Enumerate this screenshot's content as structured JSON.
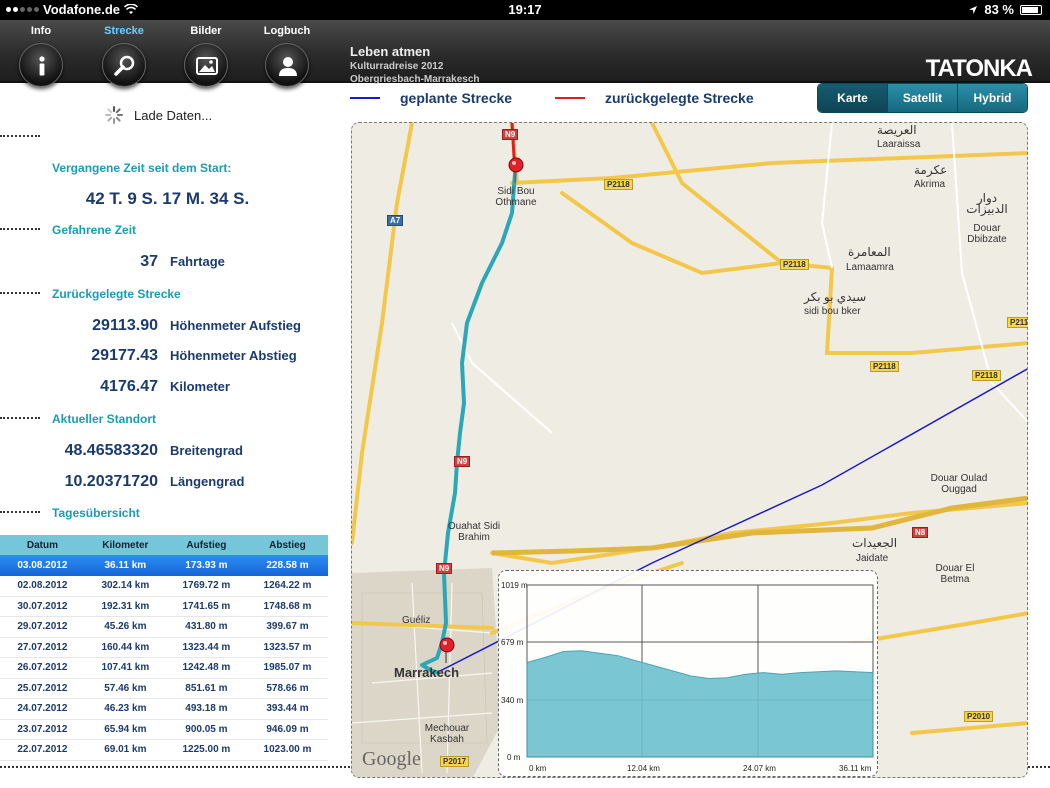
{
  "status": {
    "carrier": "Vodafone.de",
    "time": "19:17",
    "battery": "83 %"
  },
  "nav": [
    {
      "label": "Info",
      "icon": "info-icon"
    },
    {
      "label": "Strecke",
      "icon": "search-icon"
    },
    {
      "label": "Bilder",
      "icon": "image-icon"
    },
    {
      "label": "Logbuch",
      "icon": "user-icon"
    }
  ],
  "trip": {
    "title": "Leben atmen",
    "subtitle": "Kulturradreise 2012",
    "route": "Obergriesbach-Marrakesch"
  },
  "logo": "TATONKA",
  "loading": "Lade Daten...",
  "stats": {
    "elapsed_head": "Vergangene Zeit seit dem Start:",
    "elapsed": "42 T. 9 S. 17 M. 34 S.",
    "driven_head": "Gefahrene Zeit",
    "days_val": "37",
    "days_unit": "Fahrtage",
    "distance_head": "Zurückgelegte Strecke",
    "up_val": "29113.90",
    "up_unit": "Höhenmeter Aufstieg",
    "down_val": "29177.43",
    "down_unit": "Höhenmeter Abstieg",
    "km_val": "4176.47",
    "km_unit": "Kilometer",
    "pos_head": "Aktueller Standort",
    "lat_val": "48.46583320",
    "lat_unit": "Breitengrad",
    "lon_val": "10.20371720",
    "lon_unit": "Längengrad",
    "daily_head": "Tagesübersicht"
  },
  "table": {
    "headers": [
      "Datum",
      "Kilometer",
      "Aufstieg",
      "Abstieg"
    ],
    "rows": [
      [
        "03.08.2012",
        "36.11 km",
        "173.93 m",
        "228.58 m"
      ],
      [
        "02.08.2012",
        "302.14 km",
        "1769.72 m",
        "1264.22 m"
      ],
      [
        "30.07.2012",
        "192.31 km",
        "1741.65 m",
        "1748.68 m"
      ],
      [
        "29.07.2012",
        "45.26 km",
        "431.80 m",
        "399.67 m"
      ],
      [
        "27.07.2012",
        "160.44 km",
        "1323.44 m",
        "1323.57 m"
      ],
      [
        "26.07.2012",
        "107.41 km",
        "1242.48 m",
        "1985.07 m"
      ],
      [
        "25.07.2012",
        "57.46 km",
        "851.61 m",
        "578.66 m"
      ],
      [
        "24.07.2012",
        "46.23 km",
        "493.18 m",
        "393.44 m"
      ],
      [
        "23.07.2012",
        "65.94 km",
        "900.05 m",
        "946.09 m"
      ],
      [
        "22.07.2012",
        "69.01 km",
        "1225.00 m",
        "1023.00 m"
      ]
    ]
  },
  "legend": {
    "planned": "geplante Strecke",
    "traveled": "zurückgelegte Strecke",
    "planned_color": "#1a1acc",
    "traveled_color": "#e02020"
  },
  "map_types": [
    "Karte",
    "Satellit",
    "Hybrid"
  ],
  "map_labels": {
    "laaraissa_ar": "العريصة",
    "laaraissa": "Laaraissa",
    "akrima_ar": "عكرمة",
    "akrima": "Akrima",
    "dbibzate_ar": "دوار الدبيزات",
    "dbibzate": "Douar Dbibzate",
    "lamaamra_ar": "المعامرة",
    "lamaamra": "Lamaamra",
    "sidibouker_ar": "سيدي بو بكر",
    "sidibouker": "sidi bou bker",
    "sidibou": "Sidi Bou Othmane",
    "ouahat": "Ouahat Sidi Brahim",
    "ougad": "Douar Oulad Ouggad",
    "jaidate_ar": "الجعيدات",
    "jaidate": "Jaidate",
    "betma": "Douar El Betma",
    "gueliz": "Guéliz",
    "marrakech": "Marrakech",
    "kasbah": "Mechouar Kasbah",
    "google": "Google"
  },
  "road_labels": [
    "N9",
    "P2118",
    "A7",
    "P2118",
    "P2118",
    "P2118",
    "N9",
    "N8",
    "N9",
    "P2017",
    "P2010",
    "P211"
  ],
  "profile": {
    "y_ticks": [
      "1019 m",
      "679 m",
      "340 m",
      "0 m"
    ],
    "x_ticks": [
      "0 km",
      "12.04 km",
      "24.07 km",
      "36.11 km"
    ],
    "fill_color": "#6cc2cf",
    "elevation": [
      560,
      590,
      625,
      630,
      615,
      600,
      570,
      540,
      510,
      480,
      465,
      470,
      490,
      500,
      490,
      500,
      505,
      510,
      505,
      500
    ],
    "y_max": 1019
  },
  "colors": {
    "accent": "#1a9bb8",
    "text": "#1b3a6e",
    "route": "#2aa8b8"
  }
}
